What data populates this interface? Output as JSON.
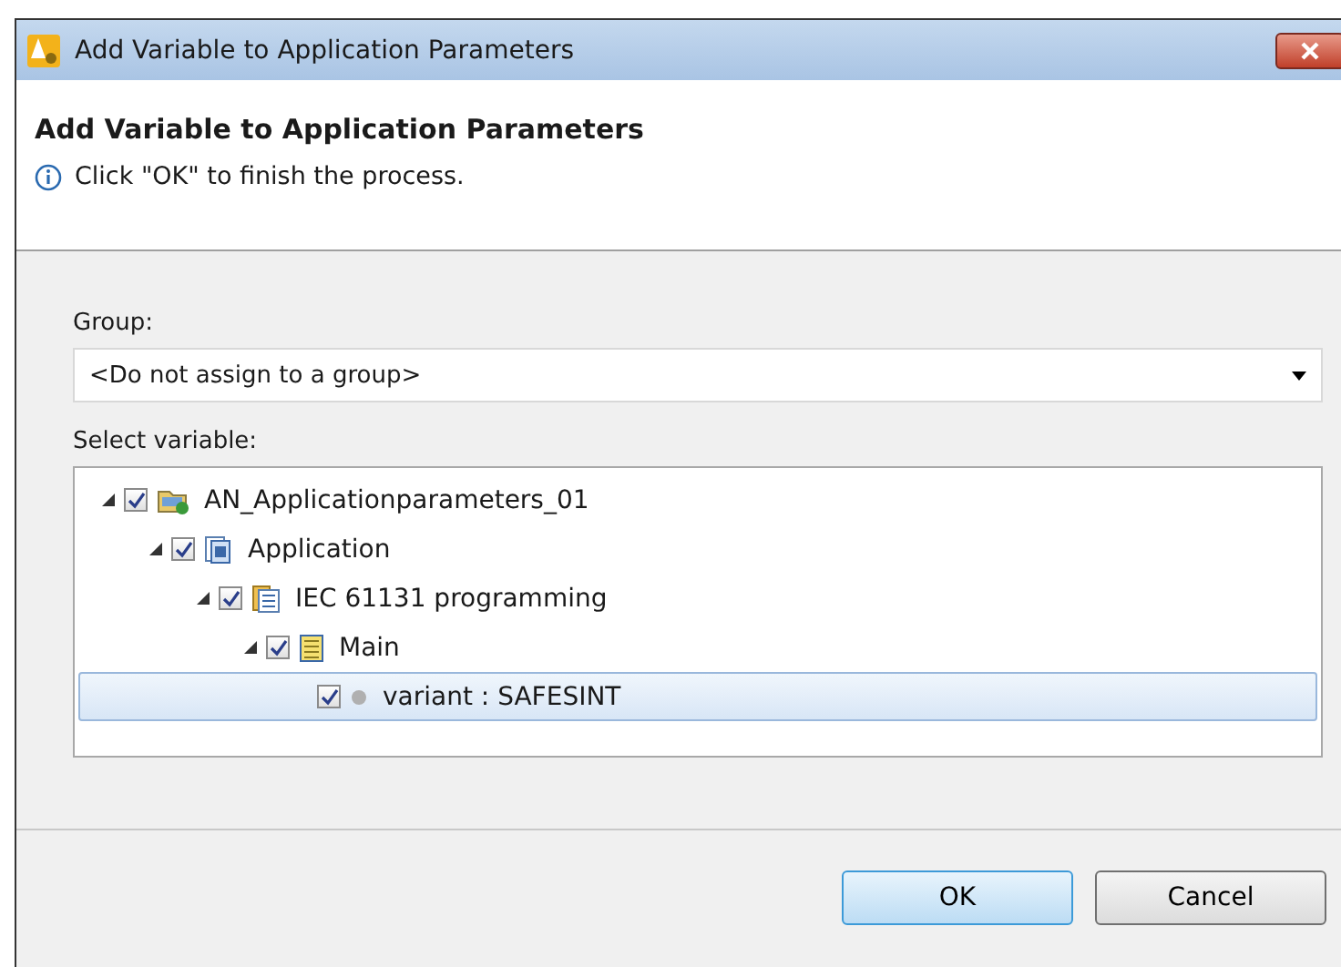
{
  "window": {
    "title": "Add Variable to Application Parameters"
  },
  "header": {
    "title": "Add Variable to Application Parameters",
    "message": "Click \"OK\" to finish the process."
  },
  "group": {
    "label": "Group:",
    "value": "<Do not assign to a group>"
  },
  "tree": {
    "label": "Select variable:",
    "items": [
      {
        "label": "AN_Applicationparameters_01",
        "kind": "project",
        "checked": true,
        "expanded": true,
        "selected": false,
        "children": [
          {
            "label": "Application",
            "kind": "application",
            "checked": true,
            "expanded": true,
            "selected": false,
            "children": [
              {
                "label": "IEC 61131 programming",
                "kind": "programming",
                "checked": true,
                "expanded": true,
                "selected": false,
                "children": [
                  {
                    "label": "Main",
                    "kind": "pou",
                    "checked": true,
                    "expanded": true,
                    "selected": false,
                    "children": [
                      {
                        "label": "variant : SAFESINT",
                        "kind": "variable",
                        "checked": true,
                        "selected": true
                      }
                    ]
                  }
                ]
              }
            ]
          }
        ]
      }
    ]
  },
  "buttons": [
    {
      "label": "OK",
      "default": true
    },
    {
      "label": "Cancel",
      "default": false
    }
  ]
}
